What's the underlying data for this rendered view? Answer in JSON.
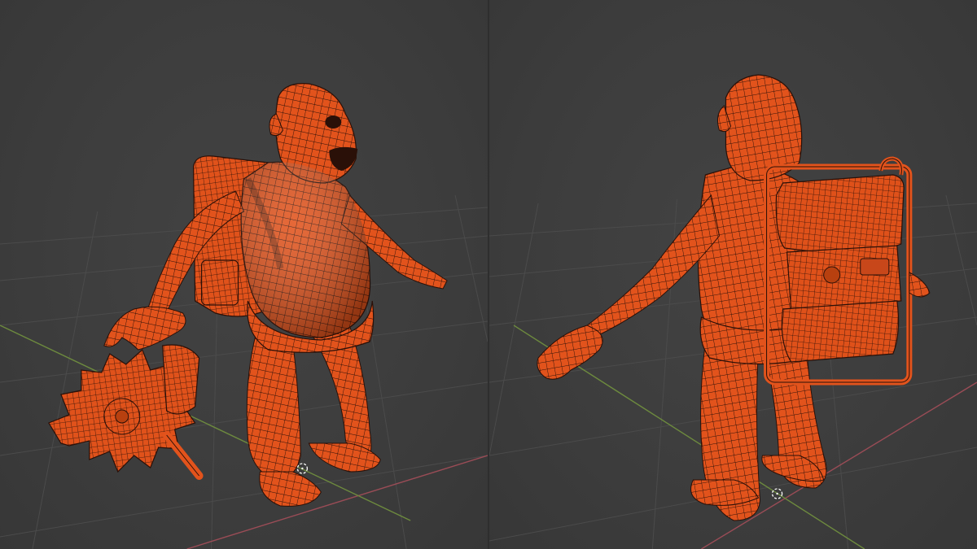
{
  "scene": {
    "background_color": "#3c3c3c",
    "grid_line_color": "#4a4a4a",
    "x_axis_color": "#9a4c56",
    "y_axis_color": "#6d8a3e",
    "model_color": "#e2531c",
    "wire_color": "#2a1008",
    "viewports": [
      {
        "view": "front-three-quarter"
      },
      {
        "view": "back-three-quarter"
      }
    ]
  }
}
